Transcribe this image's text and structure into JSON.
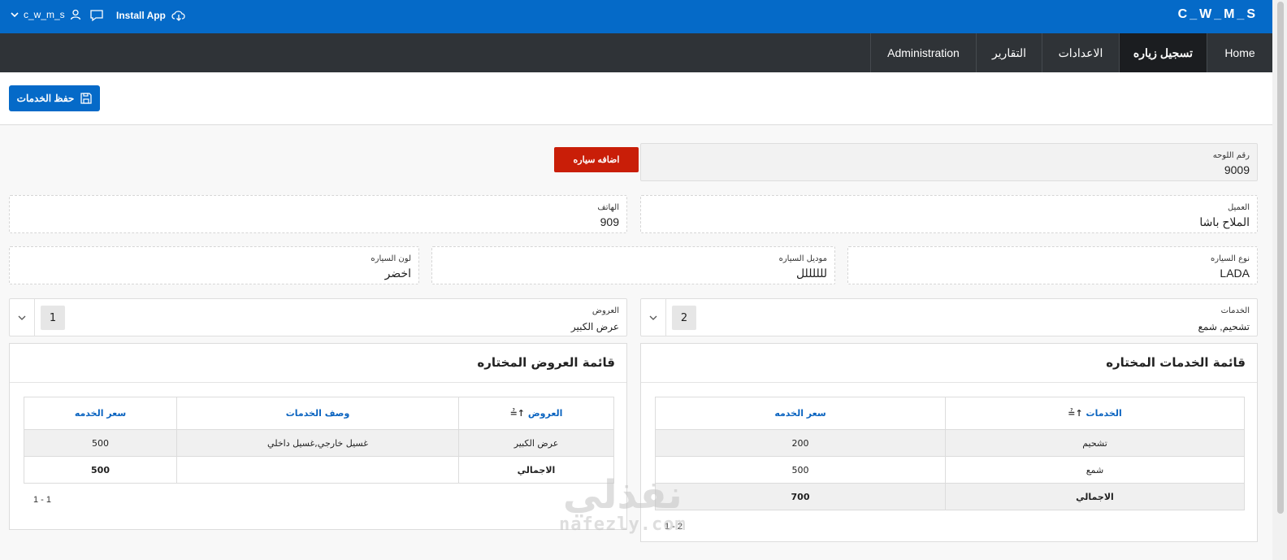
{
  "header": {
    "brand": "C_W_M_S",
    "user": "c_w_m_s",
    "install": "Install App"
  },
  "nav": {
    "tabs": [
      "Home",
      "تسجيل زياره",
      "الاعدادات",
      "التقارير",
      "Administration"
    ],
    "active": "تسجيل زياره"
  },
  "toolbar": {
    "save_label": "حفظ الخدمات"
  },
  "form": {
    "plate": {
      "label": "رقم اللوحه",
      "value": "9009"
    },
    "add_car_label": "اضافه سياره",
    "customer": {
      "label": "العميل",
      "value": "الملاح باشا"
    },
    "phone": {
      "label": "الهاتف",
      "value": "909"
    },
    "car_type": {
      "label": "نوع السياره",
      "value": "LADA"
    },
    "car_model": {
      "label": "موديل السياره",
      "value": "للللللل"
    },
    "car_color": {
      "label": "لون السياره",
      "value": "اخضر"
    },
    "services": {
      "label": "الخدمات",
      "value": "تشحيم, شمع",
      "count": "2"
    },
    "offers": {
      "label": "العروض",
      "value": "عرض الكبير",
      "count": "1"
    }
  },
  "services_report": {
    "title": "قائمة الخدمات المختاره",
    "columns": [
      "الخدمات",
      "سعر الخدمه"
    ],
    "rows": [
      [
        "تشحيم",
        "200"
      ],
      [
        "شمع",
        "500"
      ],
      [
        "الاجمالي",
        "700"
      ]
    ],
    "pager": "1 - 2"
  },
  "offers_report": {
    "title": "قائمة العروض المختاره",
    "columns": [
      "العروض",
      "وصف الخدمات",
      "سعر الخدمه"
    ],
    "rows": [
      [
        "عرض الكبير",
        "غسيل خارجي,غسيل داخلي",
        "500"
      ],
      [
        "الاجمالي",
        "",
        "500"
      ]
    ],
    "pager": "1 - 1"
  },
  "watermark": {
    "arabic": "نفذلي",
    "latin": "nafezly.com"
  },
  "colors": {
    "primary": "#056ac8",
    "nav": "#2f3337",
    "danger": "#c91e08"
  }
}
